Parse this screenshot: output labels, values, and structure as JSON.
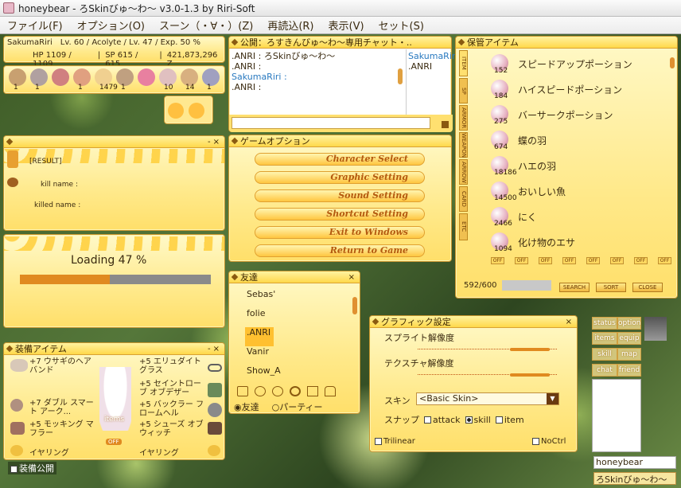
{
  "window": {
    "title": "honeybear - ろSkinびゅ～わ～ v3.0-1.3 by Riri-Soft"
  },
  "menu": [
    "ファイル(F)",
    "オプション(O)",
    "スーン（・∀・）(Z)",
    "再読込(R)",
    "表示(V)",
    "セット(S)"
  ],
  "status": {
    "name": "SakumaRiri",
    "info": "Lv. 60 / Acolyte / Lv. 47 / Exp. 50 %",
    "hp": "HP 1109 / 1109",
    "sp": "SP 615 / 615",
    "zeny": "421,873,296 Z"
  },
  "shortcut": {
    "counts": [
      "1",
      "1",
      "",
      "1",
      "1479",
      "1",
      "",
      "10",
      "14",
      "1"
    ]
  },
  "result": {
    "title": "[RESULT]",
    "kill": "kill name :",
    "killed": "killed name :"
  },
  "loading": {
    "text": "Loading 47 %",
    "progress": 47
  },
  "chat": {
    "title": "公開：ろすきんびゅ～わ～専用チャット・..",
    "lines": [
      ".ANRI : ろSkinびゅ～わ～",
      ".ANRI :",
      "SakumaRiri :",
      ".ANRI :"
    ],
    "side": [
      "SakumaRir",
      ".ANRI"
    ]
  },
  "gameopt": {
    "title": "ゲームオプション",
    "buttons": [
      "Character Select",
      "Graphic Setting",
      "Sound Setting",
      "Shortcut Setting",
      "Exit to Windows",
      "Return to Game"
    ]
  },
  "friends": {
    "title": "友達",
    "names": [
      "Sebas'",
      "folie",
      ".ANRI",
      "Vanir",
      "Show_A"
    ],
    "tab_friends": "友達",
    "tab_party": "パーティー"
  },
  "storage": {
    "title": "保管アイテム",
    "tabs": [
      "ITEM",
      "SP",
      "ARMOR",
      "WEAPON",
      "ARROW",
      "CARD",
      "ETC"
    ],
    "items": [
      {
        "name": "スピードアップポーション",
        "qty": "152"
      },
      {
        "name": "ハイスピードポーション",
        "qty": "184"
      },
      {
        "name": "バーサークポーション",
        "qty": "275"
      },
      {
        "name": "蝶の羽",
        "qty": "674"
      },
      {
        "name": "ハエの羽",
        "qty": "18186"
      },
      {
        "name": "おいしい魚",
        "qty": "14500"
      },
      {
        "name": "にく",
        "qty": "2466"
      },
      {
        "name": "化け物のエサ",
        "qty": "1094"
      }
    ],
    "count": "592/600",
    "off": [
      "OFF",
      "OFF",
      "OFF",
      "OFF",
      "OFF",
      "OFF",
      "OFF",
      "OFF"
    ],
    "search": "SEARCH",
    "sort": "SORT",
    "close": "CLOSE"
  },
  "equip": {
    "title": "装備アイテム",
    "left": [
      "+7 ウサギのヘアバンド",
      "+7 ダブル スマート アーク...",
      "+5 モッキング マフラー",
      "イヤリング"
    ],
    "right": [
      "+5 エリュダイト グラス",
      "+5 セイントローブ オブデザー",
      "+5 バックラー フロームヘル",
      "+5 シューズ オブ ウィッチ",
      "イヤリング"
    ],
    "items_label": "items",
    "off": "OFF",
    "public": "装備公開"
  },
  "graphic": {
    "title": "グラフィック設定",
    "sprite": "スプライト解像度",
    "texture": "テクスチャ解像度",
    "skin_label": "スキン",
    "skin_value": "<Basic Skin>",
    "snap": "スナップ",
    "attack": "attack",
    "skill": "skill",
    "item": "item",
    "trilinear": "Trilinear",
    "noctrl": "NoCtrl"
  },
  "sidemenu": {
    "status": "status",
    "option": "option",
    "items": "items",
    "equip": "equip",
    "skill": "skill",
    "map": "map",
    "chat": "chat",
    "friend": "friend"
  },
  "bottomright": {
    "name": "honeybear",
    "skin": "ろSkinびゅ～わ～"
  }
}
